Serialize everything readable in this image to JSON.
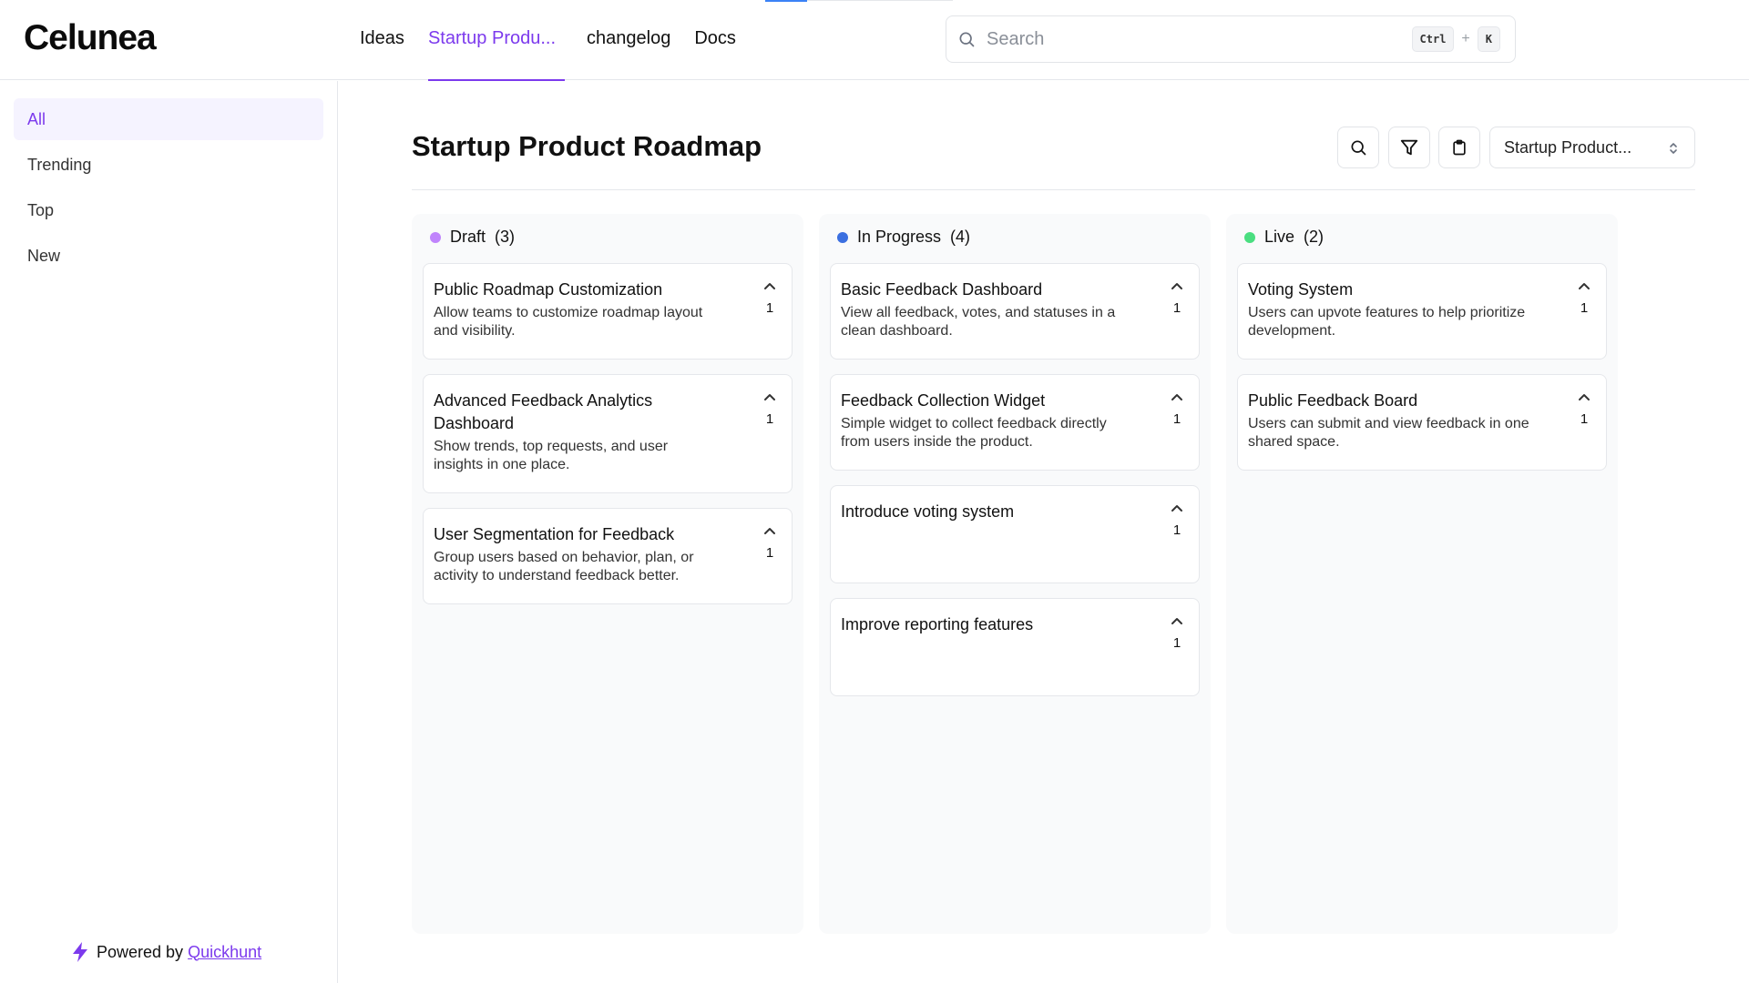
{
  "header": {
    "logo": "Celunea",
    "nav": [
      "Ideas",
      "Startup Produ...",
      "changelog",
      "Docs"
    ],
    "active_nav": 1,
    "search": {
      "placeholder": "Search",
      "shortcut_ctrl": "Ctrl",
      "shortcut_plus": "+",
      "shortcut_key": "K"
    }
  },
  "sidebar": {
    "items": [
      {
        "label": "All",
        "active": true
      },
      {
        "label": "Trending",
        "active": false
      },
      {
        "label": "Top",
        "active": false
      },
      {
        "label": "New",
        "active": false
      }
    ],
    "powered_text": "Powered by",
    "powered_link": "Quickhunt"
  },
  "main": {
    "title": "Startup Product Roadmap",
    "board_select": "Startup Product..."
  },
  "colors": {
    "accent": "#7c3aed",
    "draft": "#c084fc",
    "in_progress": "#3b6fe0",
    "live": "#4ade80"
  },
  "columns": [
    {
      "name": "Draft",
      "count": "(3)",
      "color": "#c084fc",
      "cards": [
        {
          "title": "Public Roadmap Customization",
          "description": "Allow teams to customize roadmap layout and visibility.",
          "votes": "1"
        },
        {
          "title": "Advanced Feedback Analytics Dashboard",
          "description": "Show trends, top requests, and user insights in one place.",
          "votes": "1"
        },
        {
          "title": "User Segmentation for Feedback",
          "description": "Group users based on behavior, plan, or activity to understand feedback better.",
          "votes": "1"
        }
      ]
    },
    {
      "name": "In Progress",
      "count": "(4)",
      "color": "#3b6fe0",
      "cards": [
        {
          "title": "Basic Feedback Dashboard",
          "description": "View all feedback, votes, and statuses in a clean dashboard.",
          "votes": "1"
        },
        {
          "title": "Feedback Collection Widget",
          "description": "Simple widget to collect feedback directly from users inside the product.",
          "votes": "1"
        },
        {
          "title": "Introduce voting system",
          "description": "",
          "votes": "1"
        },
        {
          "title": "Improve reporting features",
          "description": "",
          "votes": "1"
        }
      ]
    },
    {
      "name": "Live",
      "count": "(2)",
      "color": "#4ade80",
      "cards": [
        {
          "title": "Voting System",
          "description": "Users can upvote features to help prioritize development.",
          "votes": "1"
        },
        {
          "title": "Public Feedback Board",
          "description": "Users can submit and view feedback in one shared space.",
          "votes": "1"
        }
      ]
    }
  ]
}
